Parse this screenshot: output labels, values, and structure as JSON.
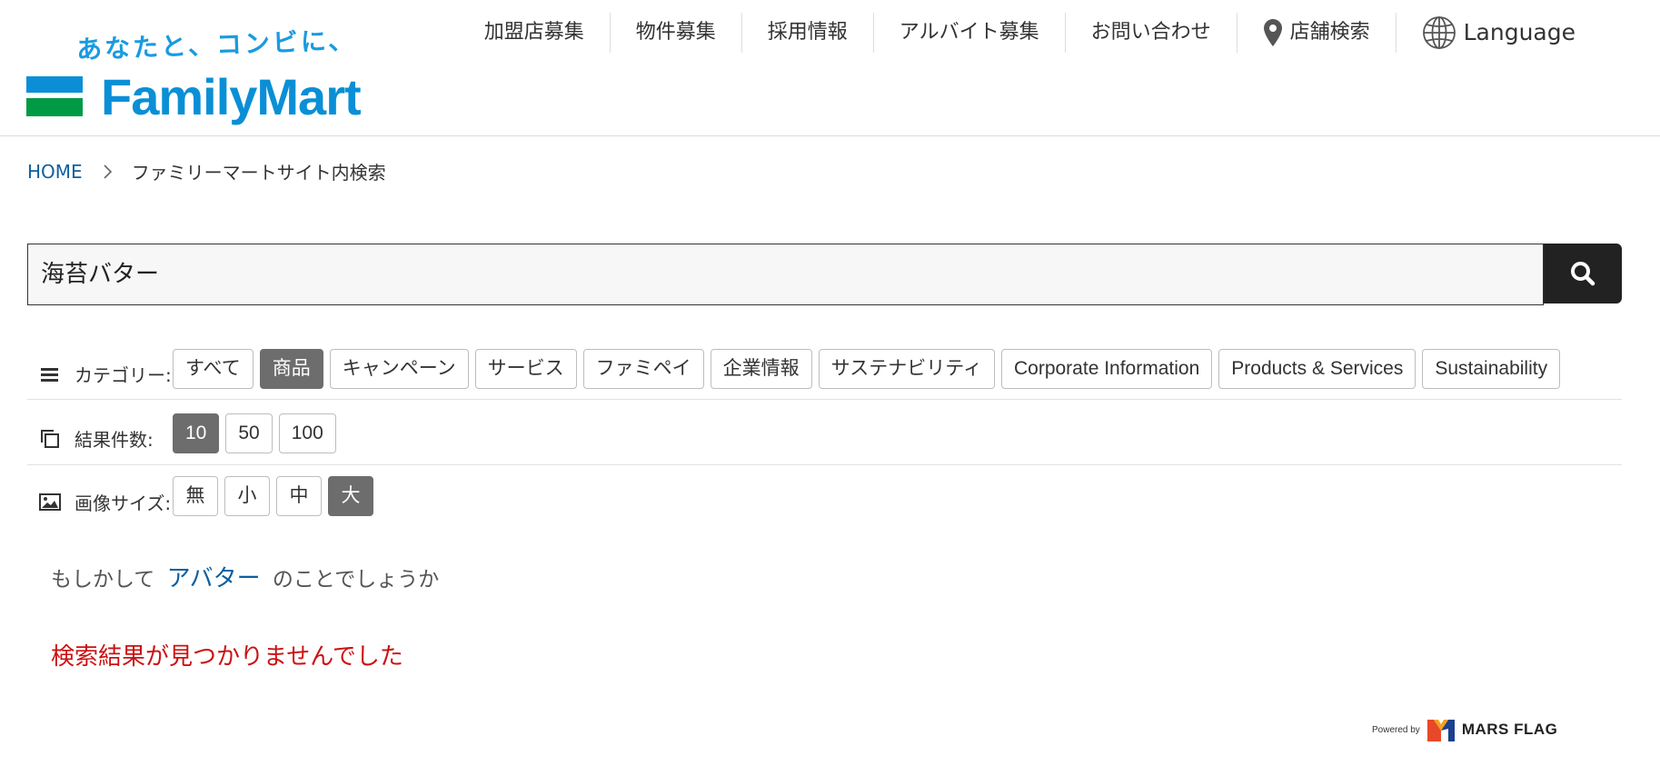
{
  "header": {
    "tagline": "あなたと、コンビに、",
    "brand": "FamilyMart",
    "nav": [
      {
        "label": "加盟店募集"
      },
      {
        "label": "物件募集"
      },
      {
        "label": "採用情報"
      },
      {
        "label": "アルバイト募集"
      },
      {
        "label": "お問い合わせ"
      },
      {
        "label": "店舗検索",
        "icon": "map-pin-icon"
      },
      {
        "label": "Language",
        "icon": "globe-icon"
      }
    ]
  },
  "breadcrumb": {
    "home": "HOME",
    "current": "ファミリーマートサイト内検索"
  },
  "search": {
    "value": "海苔バター",
    "button_icon": "search-icon"
  },
  "filters": {
    "category": {
      "label": "カテゴリー:",
      "icon": "menu-icon",
      "options": [
        "すべて",
        "商品",
        "キャンペーン",
        "サービス",
        "ファミペイ",
        "企業情報",
        "サステナビリティ",
        "Corporate Information",
        "Products & Services",
        "Sustainability"
      ],
      "selected": "商品"
    },
    "count": {
      "label": "結果件数:",
      "icon": "copy-icon",
      "options": [
        "10",
        "50",
        "100"
      ],
      "selected": "10"
    },
    "image_size": {
      "label": "画像サイズ:",
      "icon": "image-icon",
      "options": [
        "無",
        "小",
        "中",
        "大"
      ],
      "selected": "大"
    }
  },
  "suggestion": {
    "prefix": "もしかして",
    "term": "アバター",
    "suffix": "のことでしょうか"
  },
  "no_results": "検索結果が見つかりませんでした",
  "footer": {
    "powered_by": "Powered by",
    "provider": "MARS FLAG"
  },
  "colors": {
    "brand_blue": "#0a8fd6",
    "brand_green": "#009a44",
    "link": "#0f5f9e",
    "chip_active": "#6d6d6d",
    "error": "#cc1111"
  }
}
